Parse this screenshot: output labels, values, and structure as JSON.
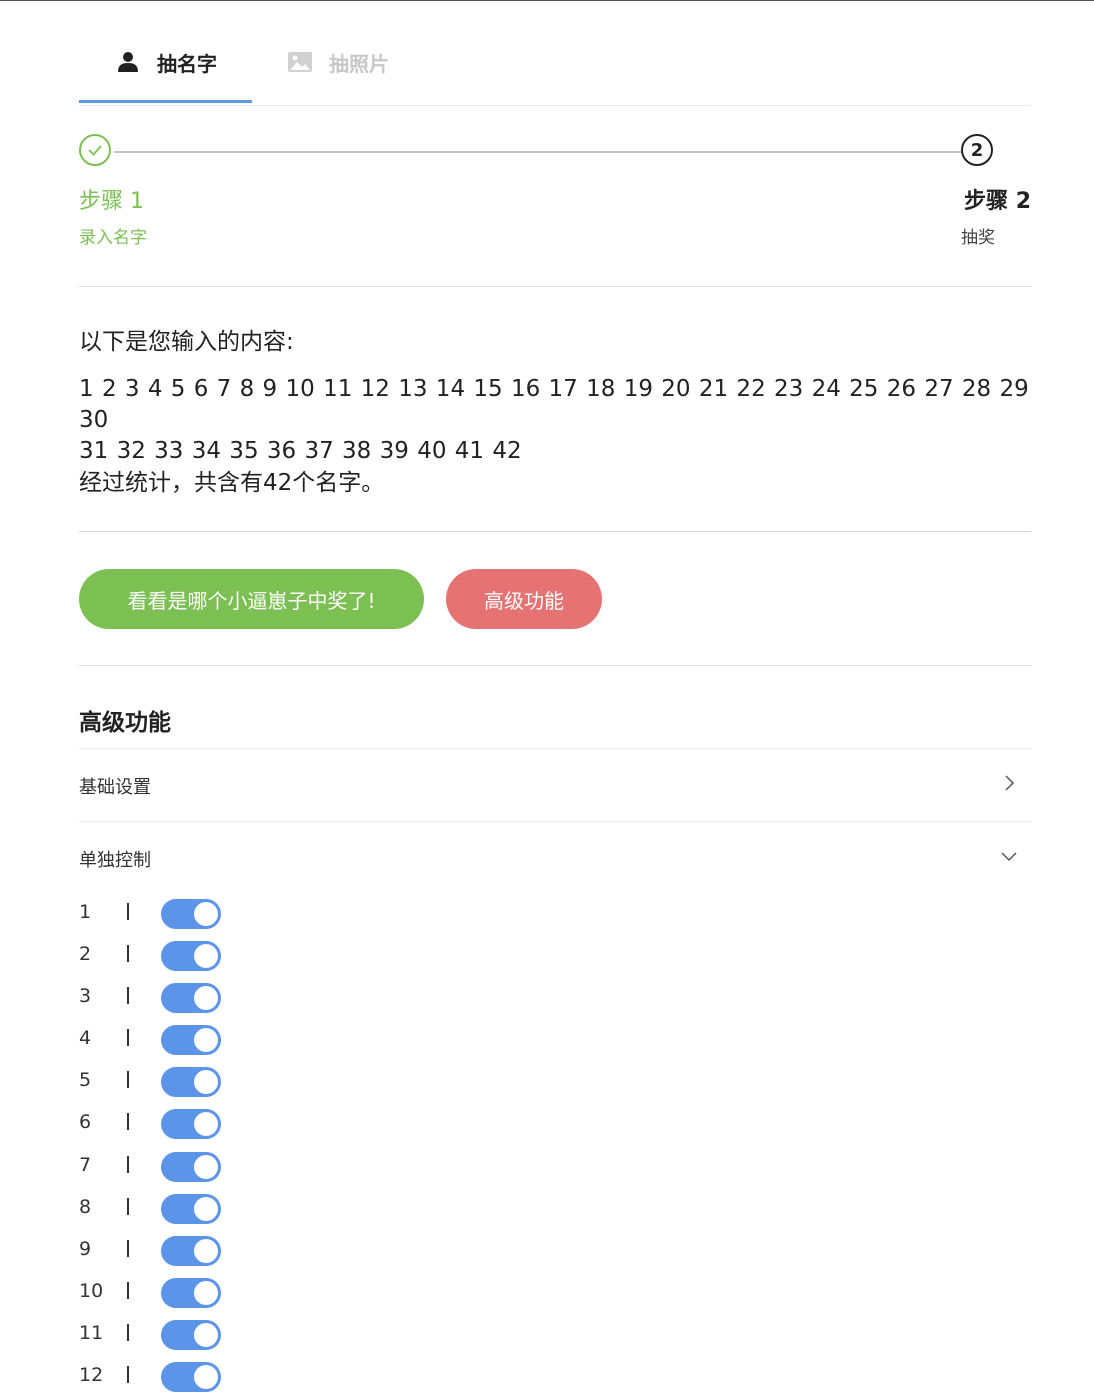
{
  "tabs": [
    {
      "label": "抽名字",
      "icon": "user-icon",
      "active": true
    },
    {
      "label": "抽照片",
      "icon": "image-icon",
      "active": false
    }
  ],
  "steps": [
    {
      "title": "步骤 1",
      "desc": "录入名字",
      "status": "done"
    },
    {
      "title": "步骤 2",
      "desc": "抽奖",
      "status": "current",
      "number": "2"
    }
  ],
  "content": {
    "intro": "以下是您输入的内容:",
    "names_line1": "1 2 3 4 5 6 7 8 9 10 11 12 13 14 15 16 17 18 19 20 21 22 23 24 25 26 27 28 29 30",
    "names_line2": "31 32 33 34 35 36 37 38 39 40 41 42",
    "count": "经过统计，共含有42个名字。"
  },
  "actions": {
    "draw_label": "看看是哪个小逼崽子中奖了!",
    "advanced_label": "高级功能"
  },
  "advanced": {
    "title": "高级功能",
    "basic_settings": "基础设置",
    "individual_control": "单独控制"
  },
  "controls": [
    {
      "label": "1",
      "on": true
    },
    {
      "label": "2",
      "on": true
    },
    {
      "label": "3",
      "on": true
    },
    {
      "label": "4",
      "on": true
    },
    {
      "label": "5",
      "on": true
    },
    {
      "label": "6",
      "on": true
    },
    {
      "label": "7",
      "on": true
    },
    {
      "label": "8",
      "on": true
    },
    {
      "label": "9",
      "on": true
    },
    {
      "label": "10",
      "on": true
    },
    {
      "label": "11",
      "on": true
    },
    {
      "label": "12",
      "on": true
    }
  ],
  "colors": {
    "accent_blue": "#5b94e8",
    "success_green": "#7cc054",
    "danger_red": "#e57373"
  }
}
